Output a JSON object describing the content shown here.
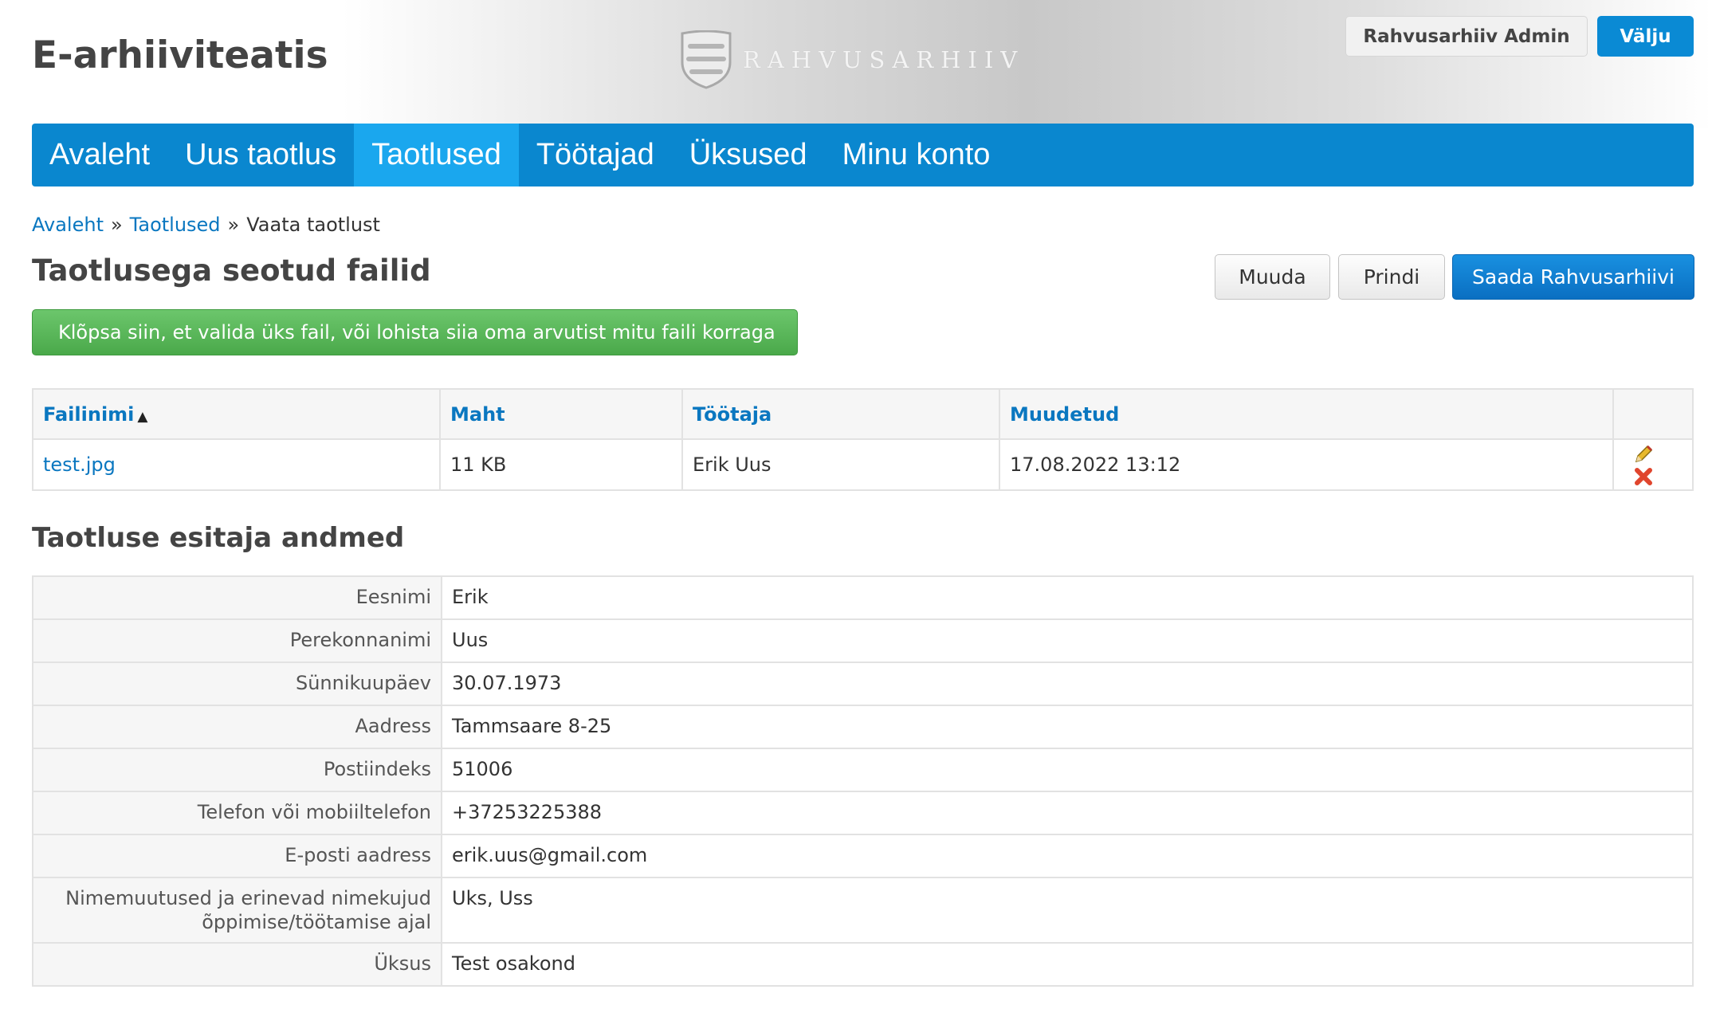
{
  "header": {
    "app_title": "E-arhiiviteatis",
    "logo_text": "RAHVUSARHIIV",
    "user_label": "Rahvusarhiiv Admin",
    "logout_label": "Välju"
  },
  "nav": {
    "items": [
      {
        "label": "Avaleht"
      },
      {
        "label": "Uus taotlus"
      },
      {
        "label": "Taotlused",
        "active": true
      },
      {
        "label": "Töötajad"
      },
      {
        "label": "Üksused"
      },
      {
        "label": "Minu konto"
      }
    ]
  },
  "breadcrumb": {
    "items": [
      "Avaleht",
      "Taotlused",
      "Vaata taotlust"
    ],
    "separator": "»"
  },
  "files_section": {
    "title": "Taotlusega seotud failid",
    "buttons": {
      "edit": "Muuda",
      "print": "Prindi",
      "send": "Saada Rahvusarhiivi"
    },
    "upload_label": "Klõpsa siin, et valida üks fail, või lohista siia oma arvutist mitu faili korraga",
    "table": {
      "headers": [
        "Failinimi",
        "Maht",
        "Töötaja",
        "Muudetud"
      ],
      "rows": [
        {
          "filename": "test.jpg",
          "size": "11 KB",
          "worker": "Erik Uus",
          "modified": "17.08.2022 13:12"
        }
      ]
    }
  },
  "applicant_section": {
    "title": "Taotluse esitaja andmed",
    "fields": [
      {
        "label": "Eesnimi",
        "value": "Erik"
      },
      {
        "label": "Perekonnanimi",
        "value": "Uus"
      },
      {
        "label": "Sünnikuupäev",
        "value": "30.07.1973"
      },
      {
        "label": "Aadress",
        "value": "Tammsaare 8-25"
      },
      {
        "label": "Postiindeks",
        "value": "51006"
      },
      {
        "label": "Telefon või mobiiltelefon",
        "value": "+37253225388"
      },
      {
        "label": "E-posti aadress",
        "value": "erik.uus@gmail.com"
      },
      {
        "label": "Nimemuutused ja erinevad nimekujud õppimise/töötamise ajal",
        "value": "Uks, Uss"
      },
      {
        "label": "Üksus",
        "value": "Test osakond"
      }
    ]
  },
  "colors": {
    "nav": "#0a87cf",
    "nav_active": "#1aa7ee",
    "link": "#0a77c0",
    "upload": "#4aa94a",
    "primary_button": "#0a6fc2"
  }
}
